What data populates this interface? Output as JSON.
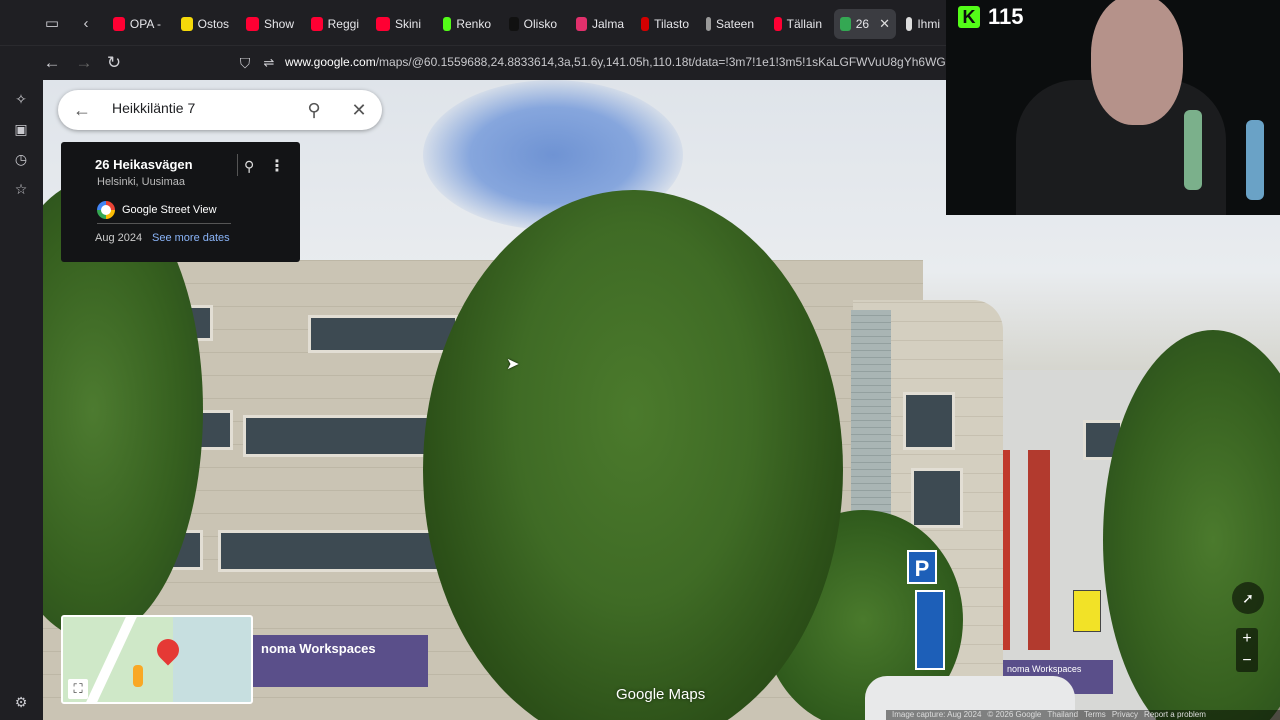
{
  "browser": {
    "tabs": [
      {
        "label": "OPA -",
        "icon": "youtube-icon",
        "color": "#ff0033"
      },
      {
        "label": "Ostos",
        "icon": "lightning-icon",
        "color": "#f5d90a"
      },
      {
        "label": "Show",
        "icon": "youtube-icon",
        "color": "#ff0033"
      },
      {
        "label": "Reggi",
        "icon": "youtube-icon",
        "color": "#ff0033"
      },
      {
        "label": "Skini",
        "icon": "youtube-icon",
        "color": "#ff0033"
      },
      {
        "label": "Renko",
        "icon": "kick-icon",
        "color": "#53fc18"
      },
      {
        "label": "Olisko",
        "icon": "tiktok-icon",
        "color": "#111111"
      },
      {
        "label": "Jalma",
        "icon": "instagram-icon",
        "color": "#e1306c"
      },
      {
        "label": "Tilasto",
        "icon": "il-icon",
        "color": "#d40000"
      },
      {
        "label": "Sateen",
        "icon": "leaf-icon",
        "color": "#999999"
      },
      {
        "label": "Tällain",
        "icon": "youtube-icon",
        "color": "#ff0033"
      },
      {
        "label": "26",
        "icon": "maps-icon",
        "color": "#34a853",
        "active": true
      },
      {
        "label": "Ihmi",
        "icon": "globe-icon",
        "color": "#dddddd"
      }
    ],
    "url_domain": "www.google.com",
    "url_rest": "/maps/@60.1559688,24.8833614,3a,51.6y,141.05h,110.18t/data=!3m7!1e1!3m5!1sKaLGFWVuU8gYh6WG0Lb"
  },
  "maps": {
    "search_value": "Heikkiläntie 7",
    "card": {
      "title": "26 Heikasvägen",
      "subtitle": "Helsinki, Uusimaa",
      "source": "Google Street View",
      "date": "Aug 2024",
      "more_dates": "See more dates"
    },
    "logo": "Google Maps",
    "footer": [
      "Image capture: Aug 2024",
      "© 2026 Google",
      "Thailand",
      "Terms",
      "Privacy",
      "Report a problem"
    ],
    "banner_text": "noma Workspaces",
    "parking_sign": "P",
    "zoom_in": "+",
    "zoom_out": "−"
  },
  "stream": {
    "viewer_count": "115",
    "platform_badge": "K"
  }
}
